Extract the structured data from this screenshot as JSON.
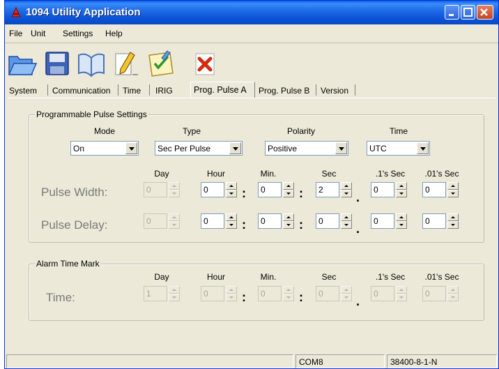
{
  "window": {
    "title": "1094 Utility Application"
  },
  "menu": [
    "File",
    "Unit",
    "Settings",
    "Help"
  ],
  "toolbar": {
    "icons": [
      "open-folder-icon",
      "save-icon",
      "book-icon",
      "pencil-icon",
      "checklist-icon",
      "close-x-icon"
    ]
  },
  "tabs": [
    "System",
    "Communication",
    "Time",
    "IRIG",
    "Prog. Pulse A",
    "Prog. Pulse B",
    "Version"
  ],
  "active_tab": "Prog. Pulse A",
  "pulse_group": {
    "title": "Programmable Pulse Settings",
    "mode_label": "Mode",
    "mode_value": "On",
    "type_label": "Type",
    "type_value": "Sec Per Pulse",
    "polarity_label": "Polarity",
    "polarity_value": "Positive",
    "time_label": "Time",
    "time_value": "UTC",
    "col_day": "Day",
    "col_hour": "Hour",
    "col_min": "Min.",
    "col_sec": "Sec",
    "col_tenth": ".1's Sec",
    "col_hundredth": ".01's Sec",
    "width_label": "Pulse Width:",
    "width_values": [
      "0",
      "0",
      "0",
      "2",
      "0",
      "0"
    ],
    "delay_label": "Pulse Delay:",
    "delay_values": [
      "0",
      "0",
      "0",
      "0",
      "0",
      "0"
    ]
  },
  "alarm_group": {
    "title": "Alarm Time Mark",
    "col_day": "Day",
    "col_hour": "Hour",
    "col_min": "Min.",
    "col_sec": "Sec",
    "col_tenth": ".1's Sec",
    "col_hundredth": ".01's Sec",
    "time_label": "Time:",
    "time_values": [
      "1",
      "0",
      "0",
      "0",
      "0",
      "0"
    ]
  },
  "separators": {
    "colon": ":",
    "dot": "."
  },
  "status": {
    "port": "COM8",
    "settings": "38400-8-1-N"
  }
}
